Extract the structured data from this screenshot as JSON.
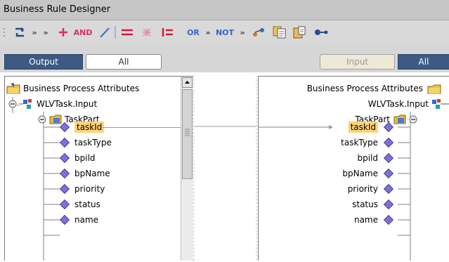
{
  "window": {
    "title": "Business Rule Designer"
  },
  "toolbar": {
    "and_label": "AND",
    "or_label": "OR",
    "not_label": "NOT",
    "chevrons": "»"
  },
  "tabs": {
    "output": "Output",
    "all_left": "All",
    "input": "Input",
    "all_right": "All"
  },
  "left_tree": {
    "root": "Business Process Attributes",
    "node": "WLVTask.Input",
    "part": "TaskPart",
    "fields": [
      "taskId",
      "taskType",
      "bpild",
      "bpName",
      "priority",
      "status",
      "name"
    ]
  },
  "right_tree": {
    "root": "Business Process Attributes",
    "node": "WLVTask.Input",
    "part": "TaskPart",
    "fields": [
      "taskId",
      "taskType",
      "bpild",
      "bpName",
      "priority",
      "status",
      "name"
    ]
  },
  "selection": {
    "left_field": "taskId",
    "right_field": "taskId"
  },
  "colors": {
    "tab_dark": "#3d5a83",
    "highlight": "#ffd27a",
    "diamond": "#7b72d6"
  }
}
